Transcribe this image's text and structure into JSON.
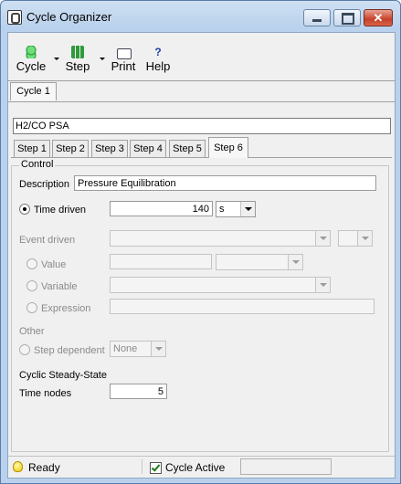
{
  "window": {
    "title": "Cycle Organizer"
  },
  "toolbar": {
    "cycle_label": "Cycle",
    "step_label": "Step",
    "print_label": "Print",
    "help_label": "Help",
    "help_glyph": "?"
  },
  "window_buttons": {
    "close_glyph": "✕"
  },
  "cycle_tabs": [
    {
      "label": "Cycle 1",
      "active": true
    }
  ],
  "cycle_name": "H2/CO PSA",
  "step_tabs": [
    {
      "label": "Step 1",
      "active": false
    },
    {
      "label": "Step 2",
      "active": false
    },
    {
      "label": "Step 3",
      "active": false
    },
    {
      "label": "Step 4",
      "active": false
    },
    {
      "label": "Step 5",
      "active": false
    },
    {
      "label": "Step 6",
      "active": true
    }
  ],
  "control": {
    "legend": "Control",
    "description_label": "Description",
    "description_value": "Pressure Equilibration",
    "time_driven_label": "Time driven",
    "time_value": "140",
    "time_unit": "s",
    "event_driven_label": "Event driven",
    "value_label": "Value",
    "variable_label": "Variable",
    "expression_label": "Expression",
    "other_label": "Other",
    "step_dependent_label": "Step dependent",
    "step_dependent_value": "None",
    "css_label": "Cyclic Steady-State",
    "time_nodes_label": "Time nodes",
    "time_nodes_value": "5"
  },
  "statusbar": {
    "ready": "Ready",
    "cycle_active": "Cycle Active"
  },
  "icons": [
    "app-icon",
    "cycle-icon",
    "step-icon",
    "print-icon",
    "help-icon",
    "bulb-icon",
    "checkbox-checked-icon"
  ],
  "colors": {
    "titlebar": "#b9d1ec",
    "close_button": "#c7412a",
    "client_bg": "#f0f0f0"
  }
}
